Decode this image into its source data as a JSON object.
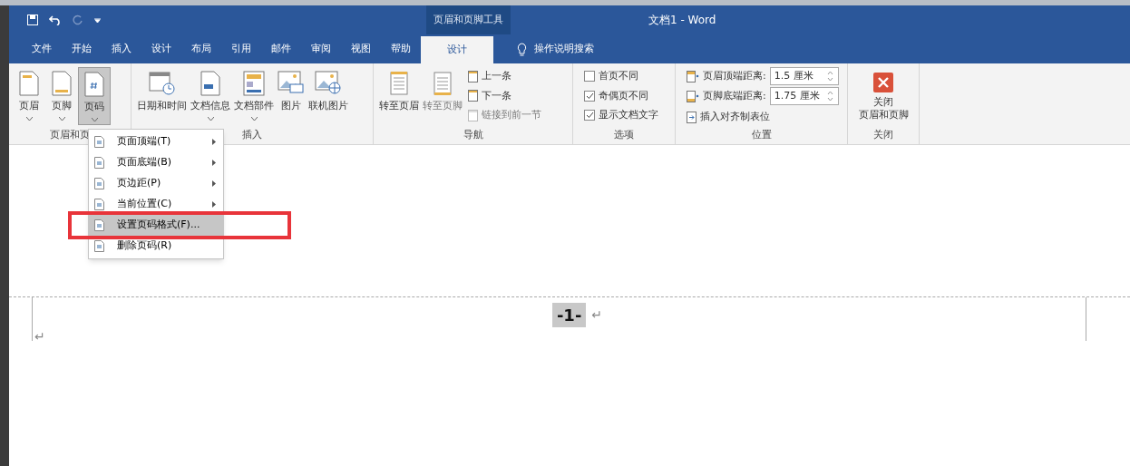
{
  "title_bar": {
    "context_tab": "页眉和页脚工具",
    "title": "文档1  -  Word"
  },
  "tabs": [
    {
      "label": "文件",
      "selected": false
    },
    {
      "label": "开始",
      "selected": false
    },
    {
      "label": "插入",
      "selected": false
    },
    {
      "label": "设计",
      "selected": false
    },
    {
      "label": "布局",
      "selected": false
    },
    {
      "label": "引用",
      "selected": false
    },
    {
      "label": "邮件",
      "selected": false
    },
    {
      "label": "审阅",
      "selected": false
    },
    {
      "label": "视图",
      "selected": false
    },
    {
      "label": "帮助",
      "selected": false
    },
    {
      "label": "设计",
      "selected": true
    }
  ],
  "tell_me": {
    "placeholder": "操作说明搜索"
  },
  "ribbon": {
    "header_footer": {
      "label": "页眉和页",
      "buttons": [
        {
          "label": "页眉",
          "kind": "header",
          "selected": false
        },
        {
          "label": "页脚",
          "kind": "footer",
          "selected": false
        },
        {
          "label": "页码",
          "kind": "number",
          "selected": true
        }
      ]
    },
    "insert": {
      "label": "插入",
      "buttons": [
        {
          "label": "日期和时间",
          "kind": "calendar",
          "dropdown": false
        },
        {
          "label": "文档信息",
          "kind": "docinfo",
          "dropdown": true
        },
        {
          "label": "文档部件",
          "kind": "parts",
          "dropdown": true
        },
        {
          "label": "图片",
          "kind": "picture",
          "dropdown": false
        },
        {
          "label": "联机图片",
          "kind": "online",
          "dropdown": false
        }
      ]
    },
    "navigation": {
      "label": "导航",
      "large": [
        {
          "label": "转至页眉",
          "disabled": false
        },
        {
          "label": "转至页脚",
          "disabled": true
        }
      ],
      "small": [
        {
          "label": "上一条",
          "disabled": false
        },
        {
          "label": "下一条",
          "disabled": false
        },
        {
          "label": "链接到前一节",
          "disabled": true
        }
      ]
    },
    "options": {
      "label": "选项",
      "items": [
        {
          "label": "首页不同",
          "checked": false
        },
        {
          "label": "奇偶页不同",
          "checked": true
        },
        {
          "label": "显示文档文字",
          "checked": true
        }
      ]
    },
    "position": {
      "label": "位置",
      "fields": [
        {
          "label": "页眉顶端距离:",
          "value": "1.5 厘米"
        },
        {
          "label": "页脚底端距离:",
          "value": "1.75 厘米"
        }
      ],
      "action": "插入对齐制表位"
    },
    "close": {
      "label": "关闭",
      "button_lines": [
        "关闭",
        "页眉和页脚"
      ]
    }
  },
  "menu": {
    "items": [
      {
        "label": "页面顶端(T)",
        "kind": "submenu",
        "selected": false
      },
      {
        "label": "页面底端(B)",
        "kind": "submenu",
        "selected": false
      },
      {
        "label": "页边距(P)",
        "kind": "submenu",
        "selected": false
      },
      {
        "label": "当前位置(C)",
        "kind": "submenu",
        "selected": false
      },
      {
        "label": "设置页码格式(F)...",
        "kind": "action",
        "selected": true
      },
      {
        "label": "删除页码(R)",
        "kind": "action",
        "selected": false
      }
    ]
  },
  "document": {
    "page_number": "-1-",
    "header_mark": "↵",
    "body_mark": "↵"
  }
}
